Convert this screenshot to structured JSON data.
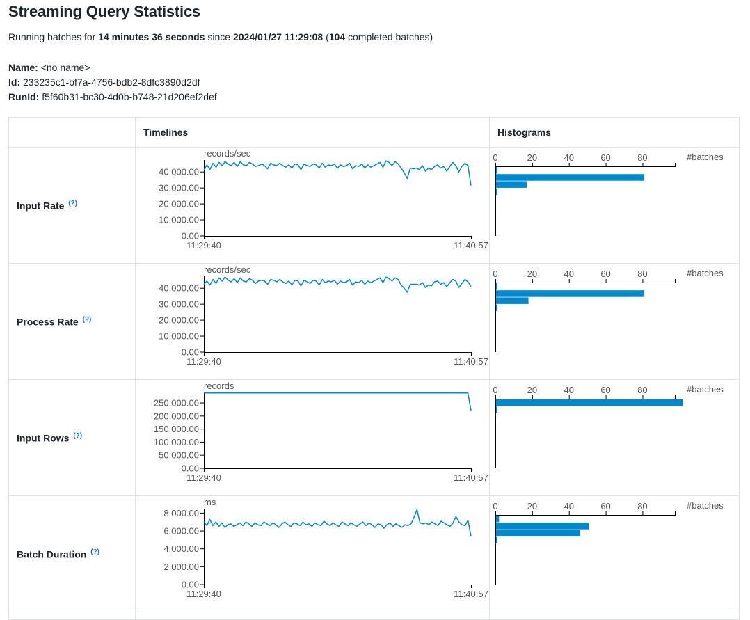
{
  "page": {
    "title": "Streaming Query Statistics"
  },
  "summary": {
    "prefix": "Running batches for ",
    "duration": "14 minutes 36 seconds",
    "since_label": " since ",
    "since": "2024/01/27 11:29:08",
    "open_paren": " (",
    "completed_count": "104",
    "completed_suffix": " completed batches)"
  },
  "query": {
    "name_label": "Name:",
    "name": "<no name>",
    "id_label": "Id:",
    "id": "233235c1-bf7a-4756-bdb2-8dfc3890d2df",
    "runid_label": "RunId:",
    "runid": "f5f60b31-bc30-4d0b-b748-21d206ef2def"
  },
  "table": {
    "col_timelines": "Timelines",
    "col_histograms": "Histograms"
  },
  "colors": {
    "series": "#0088cc",
    "axis": "#000000",
    "label": "#555555"
  },
  "help_icon": "(?)",
  "chart_data": [
    {
      "type": "line",
      "title": "Input Rate",
      "unit": "records/sec",
      "x_ticks": [
        "11:29:40",
        "11:40:57"
      ],
      "y_ticks": [
        "0.00",
        "10,000.00",
        "20,000.00",
        "30,000.00",
        "40,000.00"
      ],
      "ylim": [
        0,
        47500
      ],
      "y": [
        41000,
        44500,
        41500,
        45500,
        43000,
        46000,
        44000,
        46500,
        45000,
        44000,
        46000,
        43500,
        46500,
        44500,
        44000,
        46000,
        45000,
        43500,
        44000,
        45000,
        44000,
        42000,
        45500,
        44500,
        44000,
        45500,
        44000,
        43000,
        44500,
        42500,
        45000,
        44500,
        41500,
        45000,
        44000,
        43500,
        45000,
        44500,
        42500,
        45500,
        43000,
        44500,
        44000,
        45000,
        42500,
        44500,
        43500,
        44000,
        45500,
        42000,
        44000,
        43500,
        45000,
        42500,
        44500,
        43000,
        44000,
        45000,
        46000,
        43000,
        47000,
        46000,
        44000,
        46500,
        45000,
        42500,
        39500,
        36000,
        42500,
        42000,
        42500,
        41500,
        44000,
        40500,
        42500,
        41500,
        43500,
        44500,
        42500,
        43500,
        40500,
        43500,
        46000,
        44000,
        40000,
        43500,
        45500,
        44000,
        31500
      ],
      "histogram": {
        "axis_label": "#batches",
        "x_ticks": [
          0,
          20,
          40,
          60,
          80
        ],
        "xlim": [
          0,
          98
        ],
        "bins": [
          1,
          81,
          17,
          1
        ]
      }
    },
    {
      "type": "line",
      "title": "Process Rate",
      "unit": "records/sec",
      "x_ticks": [
        "11:29:40",
        "11:40:57"
      ],
      "y_ticks": [
        "0.00",
        "10,000.00",
        "20,000.00",
        "30,000.00",
        "40,000.00"
      ],
      "ylim": [
        0,
        47500
      ],
      "y": [
        42500,
        44500,
        42000,
        45500,
        43000,
        46500,
        44500,
        47000,
        45000,
        44000,
        46000,
        43500,
        46500,
        44500,
        44000,
        46000,
        45000,
        43000,
        44500,
        45000,
        44500,
        42500,
        45500,
        45000,
        44000,
        45500,
        44000,
        43000,
        44500,
        42000,
        45000,
        44500,
        41500,
        45000,
        44000,
        43000,
        45000,
        44500,
        42000,
        45500,
        43500,
        44500,
        44000,
        45000,
        42500,
        44500,
        43500,
        44000,
        45500,
        42000,
        44000,
        43500,
        45000,
        42500,
        44500,
        43500,
        44500,
        45500,
        46500,
        43500,
        47000,
        46000,
        44500,
        46500,
        45500,
        42000,
        40000,
        37500,
        42500,
        42500,
        42500,
        42000,
        43500,
        40500,
        42000,
        41500,
        44000,
        44500,
        42500,
        43500,
        41000,
        43500,
        45500,
        44500,
        40500,
        43000,
        45500,
        44000,
        41000
      ],
      "histogram": {
        "axis_label": "#batches",
        "x_ticks": [
          0,
          20,
          40,
          60,
          80
        ],
        "xlim": [
          0,
          98
        ],
        "bins": [
          1,
          81,
          18,
          1
        ]
      }
    },
    {
      "type": "line",
      "title": "Input Rows",
      "unit": "records",
      "x_ticks": [
        "11:29:40",
        "11:40:57"
      ],
      "y_ticks": [
        "0.00",
        "50,000.00",
        "100,000.00",
        "150,000.00",
        "200,000.00",
        "250,000.00"
      ],
      "ylim": [
        0,
        290000
      ],
      "y": [
        288000,
        288000,
        288000,
        288000,
        288000,
        288000,
        288000,
        288000,
        288000,
        288000,
        288000,
        288000,
        288000,
        288000,
        288000,
        288000,
        288000,
        288000,
        288000,
        288000,
        288000,
        288000,
        288000,
        288000,
        288000,
        288000,
        288000,
        288000,
        288000,
        288000,
        288000,
        288000,
        288000,
        288000,
        288000,
        288000,
        288000,
        288000,
        288000,
        288000,
        288000,
        288000,
        288000,
        288000,
        288000,
        288000,
        288000,
        288000,
        288000,
        288000,
        288000,
        288000,
        288000,
        288000,
        288000,
        288000,
        288000,
        288000,
        288000,
        288000,
        288000,
        288000,
        288000,
        288000,
        288000,
        288000,
        288000,
        288000,
        288000,
        288000,
        288000,
        288000,
        288000,
        288000,
        288000,
        288000,
        288000,
        288000,
        288000,
        288000,
        288000,
        288000,
        288000,
        288000,
        288000,
        288000,
        288000,
        288000,
        220000
      ],
      "histogram": {
        "axis_label": "#batches",
        "x_ticks": [
          0,
          20,
          40,
          60,
          80
        ],
        "xlim": [
          0,
          98
        ],
        "bins": [
          102,
          1
        ]
      }
    },
    {
      "type": "line",
      "title": "Batch Duration",
      "unit": "ms",
      "x_ticks": [
        "11:29:40",
        "11:40:57"
      ],
      "y_ticks": [
        "0.00",
        "2,000.00",
        "4,000.00",
        "6,000.00",
        "8,000.00"
      ],
      "ylim": [
        0,
        8500
      ],
      "y": [
        7000,
        6600,
        7300,
        6600,
        7000,
        6500,
        6900,
        6400,
        6700,
        6800,
        6500,
        6700,
        6900,
        6600,
        7000,
        6800,
        6500,
        6900,
        6700,
        6600,
        7000,
        6800,
        6600,
        6900,
        6700,
        6400,
        6800,
        7000,
        6700,
        6500,
        6900,
        6800,
        6600,
        7000,
        6700,
        6800,
        6500,
        6900,
        6700,
        6600,
        7100,
        6800,
        6600,
        6900,
        6700,
        6500,
        7000,
        6800,
        6600,
        6900,
        6700,
        6500,
        6800,
        7000,
        6600,
        6900,
        6700,
        6400,
        6800,
        6700,
        6300,
        6700,
        6900,
        6500,
        6800,
        6600,
        6400,
        6700,
        6600,
        6800,
        7500,
        8400,
        6900,
        6800,
        6900,
        6700,
        7000,
        6800,
        6600,
        7100,
        6900,
        6700,
        6500,
        6900,
        7600,
        7000,
        6700,
        6600,
        7200,
        5400
      ],
      "histogram": {
        "axis_label": "#batches",
        "x_ticks": [
          0,
          20,
          40,
          60,
          80
        ],
        "xlim": [
          0,
          98
        ],
        "bins": [
          2,
          51,
          46,
          1
        ]
      }
    }
  ]
}
